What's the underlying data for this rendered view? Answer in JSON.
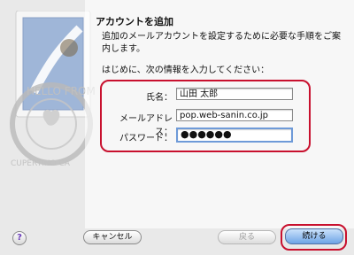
{
  "dialog": {
    "title": "アカウントを追加",
    "description": "追加のメールアカウントを設定するために必要な手順をご案内します。",
    "lead": "はじめに、次の情報を入力してください："
  },
  "form": {
    "name_label": "氏名：",
    "name_value": "山田 太郎",
    "email_label": "メールアドレス：",
    "email_value": "pop.web-sanin.co.jp",
    "password_label": "パスワード：",
    "password_mask": "●●●●●●"
  },
  "buttons": {
    "help": "?",
    "cancel": "キャンセル",
    "back": "戻る",
    "continue": "続ける"
  },
  "stamp_text": {
    "top": "HELLO FROM",
    "bottom": "CUPERTINO CA"
  },
  "colors": {
    "highlight": "#c8102e",
    "default_button": "#6ea4e6",
    "focus_ring": "#6e9ad8"
  }
}
